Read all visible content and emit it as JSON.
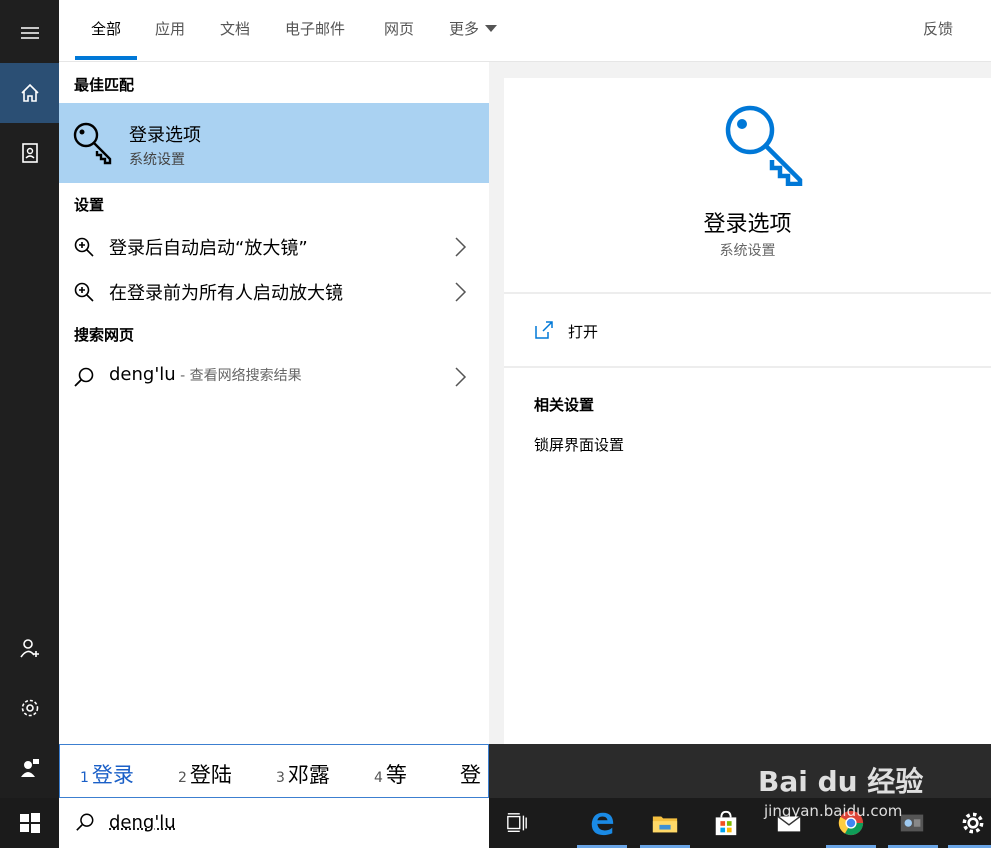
{
  "tabs": {
    "all": "全部",
    "apps": "应用",
    "documents": "文档",
    "email": "电子邮件",
    "web": "网页",
    "more": "更多",
    "feedback": "反馈"
  },
  "results": {
    "best_match_header": "最佳匹配",
    "best_match": {
      "title": "登录选项",
      "subtitle": "系统设置"
    },
    "settings_header": "设置",
    "settings_items": [
      "登录后自动启动“放大镜”",
      "在登录前为所有人启动放大镜"
    ],
    "web_header": "搜索网页",
    "web_item": {
      "query": "deng'lu",
      "suffix": " - 查看网络搜索结果"
    }
  },
  "detail": {
    "title": "登录选项",
    "subtitle": "系统设置",
    "open_label": "打开",
    "related_header": "相关设置",
    "related_items": [
      "锁屏界面设置"
    ]
  },
  "ime": {
    "candidates": [
      {
        "n": "1",
        "text": "登录"
      },
      {
        "n": "2",
        "text": "登陆"
      },
      {
        "n": "3",
        "text": "邓露"
      },
      {
        "n": "4",
        "text": "等"
      },
      {
        "n": "",
        "text": "登"
      }
    ]
  },
  "search": {
    "query": "deng'lu"
  },
  "watermark": {
    "brand": "Bai du 经验",
    "url": "jingyan.baidu.com"
  },
  "icons": {
    "menu": "hamburger-icon",
    "home": "home-icon",
    "notebook": "notebook-icon",
    "account": "add-account-icon",
    "settings": "gear-icon",
    "feedback": "feedback-person-icon",
    "start": "windows-icon"
  },
  "colors": {
    "accent": "#0078d7",
    "selected_bg": "#aad2f2",
    "rail_bg": "#1f1f1f",
    "rail_active": "#2b4f74"
  }
}
